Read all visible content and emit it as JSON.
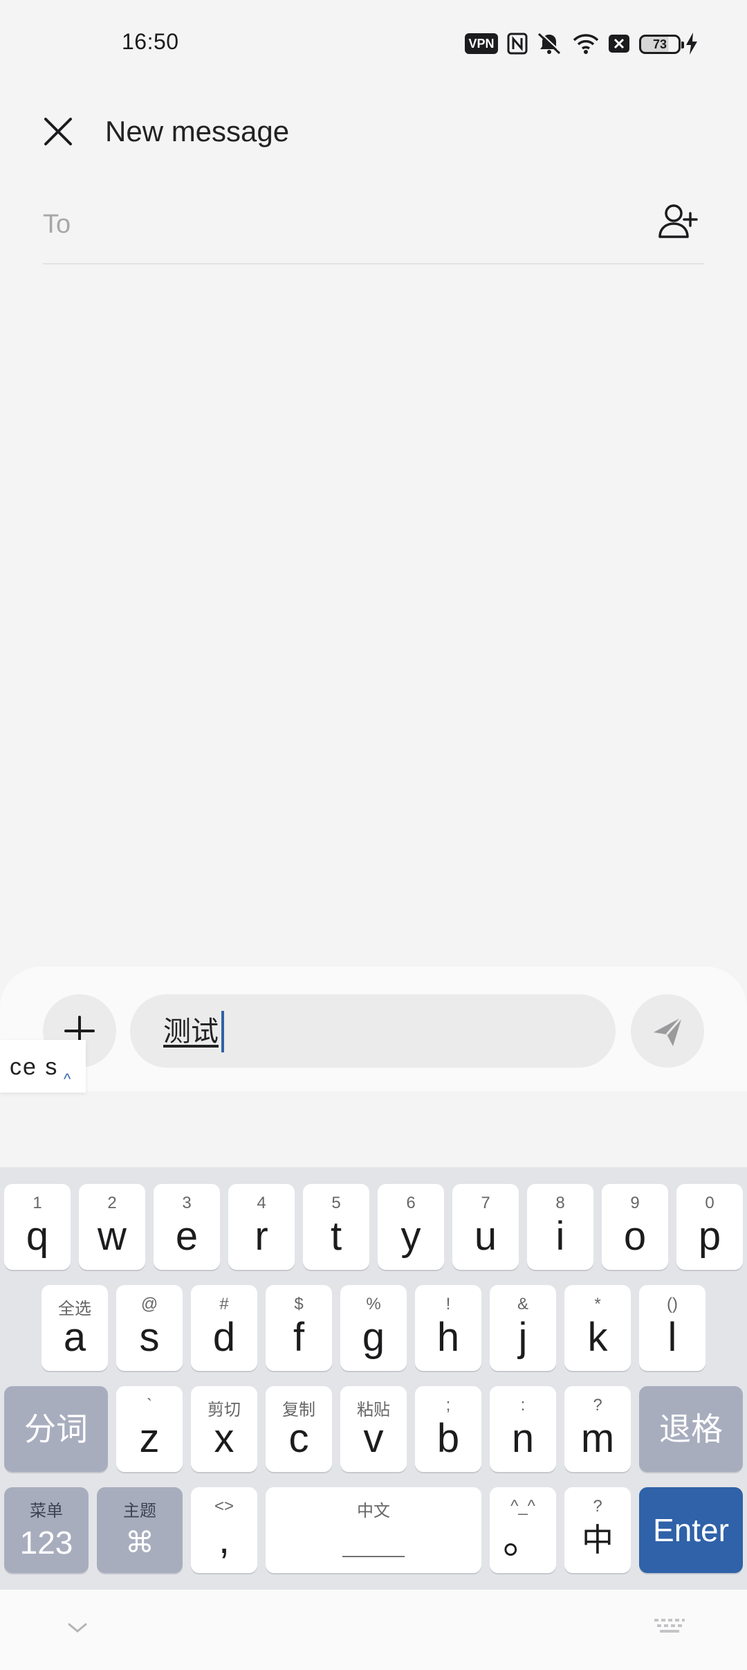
{
  "status_bar": {
    "time": "16:50",
    "vpn_label": "VPN",
    "battery_level": "73",
    "icons": [
      "vpn-icon",
      "nfc-icon",
      "mute-icon",
      "wifi-icon",
      "sim-off-icon",
      "battery-icon",
      "charging-icon"
    ]
  },
  "header": {
    "title": "New message",
    "close_icon": "close-icon"
  },
  "recipient": {
    "placeholder": "To",
    "add_contact_icon": "add-contact-icon"
  },
  "composer": {
    "attach_icon": "plus-icon",
    "text": "测试",
    "send_icon": "send-icon"
  },
  "ime_popup": {
    "text": "ce s",
    "arrow": "^"
  },
  "keyboard": {
    "row1": [
      {
        "sub": "1",
        "main": "q"
      },
      {
        "sub": "2",
        "main": "w"
      },
      {
        "sub": "3",
        "main": "e"
      },
      {
        "sub": "4",
        "main": "r"
      },
      {
        "sub": "5",
        "main": "t"
      },
      {
        "sub": "6",
        "main": "y"
      },
      {
        "sub": "7",
        "main": "u"
      },
      {
        "sub": "8",
        "main": "i"
      },
      {
        "sub": "9",
        "main": "o"
      },
      {
        "sub": "0",
        "main": "p"
      }
    ],
    "row2": [
      {
        "sub": "全选",
        "main": "a"
      },
      {
        "sub": "@",
        "main": "s"
      },
      {
        "sub": "#",
        "main": "d"
      },
      {
        "sub": "$",
        "main": "f"
      },
      {
        "sub": "%",
        "main": "g"
      },
      {
        "sub": "!",
        "main": "h"
      },
      {
        "sub": "&",
        "main": "j"
      },
      {
        "sub": "*",
        "main": "k"
      },
      {
        "sub": "()",
        "main": "l"
      }
    ],
    "row3": [
      {
        "sub": "`",
        "main": "z"
      },
      {
        "sub": "剪切",
        "main": "x"
      },
      {
        "sub": "复制",
        "main": "c"
      },
      {
        "sub": "粘贴",
        "main": "v"
      },
      {
        "sub": ";",
        "main": "b"
      },
      {
        "sub": ":",
        "main": "n"
      },
      {
        "sub": "?",
        "main": "m"
      }
    ],
    "segment_key": "分词",
    "backspace_key": "退格",
    "row4": {
      "num": {
        "sub": "菜单",
        "main": "123"
      },
      "theme": {
        "sub": "主题",
        "main": "⌘"
      },
      "comma": {
        "sub": "<>",
        "main": ","
      },
      "space": {
        "sub": "中文",
        "main": "＿＿＿"
      },
      "period": {
        "sub": "^_^",
        "main": "。"
      },
      "lang": {
        "sub": "?",
        "main": "中"
      },
      "enter": "Enter"
    }
  },
  "bottom_bar": {
    "hide_icon": "chevron-down-icon",
    "keyboard_icon": "keyboard-icon"
  },
  "colors": {
    "accent": "#2f62a8",
    "function_key": "#a8adbe",
    "background": "#f4f4f5"
  }
}
